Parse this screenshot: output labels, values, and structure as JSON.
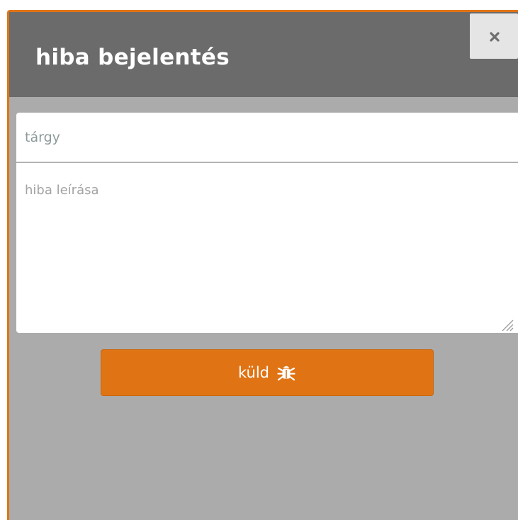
{
  "dialog": {
    "title": "hiba bejelentés",
    "close_icon": "close-icon"
  },
  "form": {
    "subject_placeholder": "tárgy",
    "subject_value": "",
    "description_placeholder": "hiba leírása",
    "description_value": "",
    "send_label": "küld",
    "send_icon": "bug-icon"
  },
  "colors": {
    "accent": "#e07415",
    "header_bg": "#6b6b6b",
    "body_bg": "#ababab",
    "close_bg": "#e5e5e5"
  }
}
